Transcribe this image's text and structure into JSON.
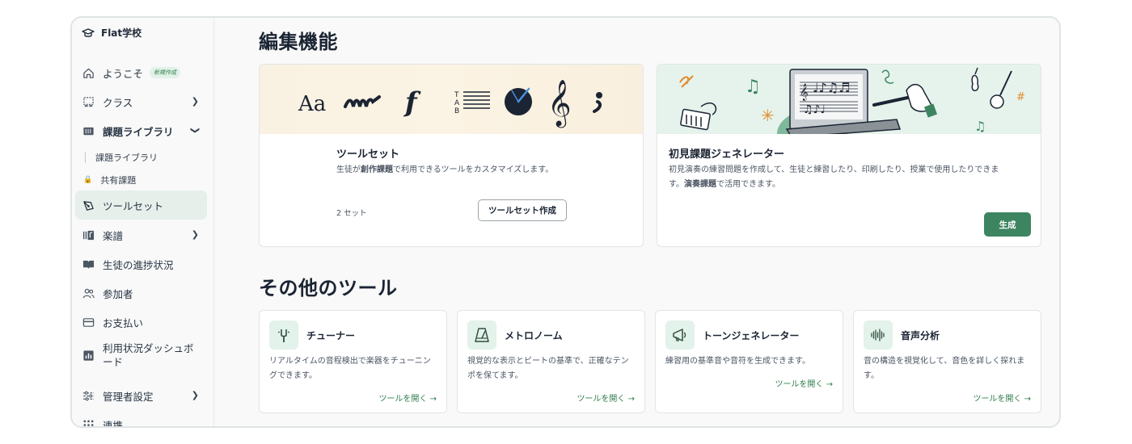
{
  "brand": {
    "name": "Flat学校"
  },
  "sidebar": {
    "items": [
      {
        "label": "ようこそ",
        "badge": "新規作成"
      },
      {
        "label": "クラス"
      },
      {
        "label": "課題ライブラリ"
      },
      {
        "label": "ツールセット"
      },
      {
        "label": "楽譜"
      },
      {
        "label": "生徒の進捗状況"
      },
      {
        "label": "参加者"
      },
      {
        "label": "お支払い"
      },
      {
        "label": "利用状況ダッシュボード"
      },
      {
        "label": "管理者設定"
      },
      {
        "label": "連携"
      }
    ],
    "sub_items": [
      {
        "label": "課題ライブラリ"
      },
      {
        "label": "共有課題"
      }
    ]
  },
  "main": {
    "section1_title": "編集機能",
    "section2_title": "その他のツール",
    "toolset_card": {
      "title": "ツールセット",
      "desc_pre": "生徒が",
      "desc_bold": "創作課題",
      "desc_post": "で利用できるツールをカスタマイズします。",
      "count": "2 セット",
      "button": "ツールセット作成",
      "hero_text": "Aa"
    },
    "generator_card": {
      "title": "初見課題ジェネレーター",
      "desc1": "初見演奏の練習問題を作成して、生徒と練習したり、印刷したり、授業で使用したりできま",
      "desc2_pre": "す。",
      "desc2_bold": "演奏課題",
      "desc2_post": "で活用できます。",
      "button": "生成"
    },
    "tools": [
      {
        "title": "チューナー",
        "desc": "リアルタイムの音程検出で楽器をチューニングできます。",
        "link": "ツールを開く →",
        "icon": "tuning-fork-icon"
      },
      {
        "title": "メトロノーム",
        "desc": "視覚的な表示とビートの基準で、正確なテンポを保てます。",
        "link": "ツールを開く →",
        "icon": "metronome-icon"
      },
      {
        "title": "トーンジェネレーター",
        "desc": "練習用の基準音や音符を生成できます。",
        "link": "ツールを開く →",
        "icon": "megaphone-icon"
      },
      {
        "title": "音声分析",
        "desc": "音の構造を視覚化して、音色を詳しく探れます。",
        "link": "ツールを開く →",
        "icon": "waveform-icon"
      }
    ]
  },
  "colors": {
    "accent": "#3d8560",
    "active_bg": "#e6efea",
    "badge_bg": "#e2f2e8"
  }
}
